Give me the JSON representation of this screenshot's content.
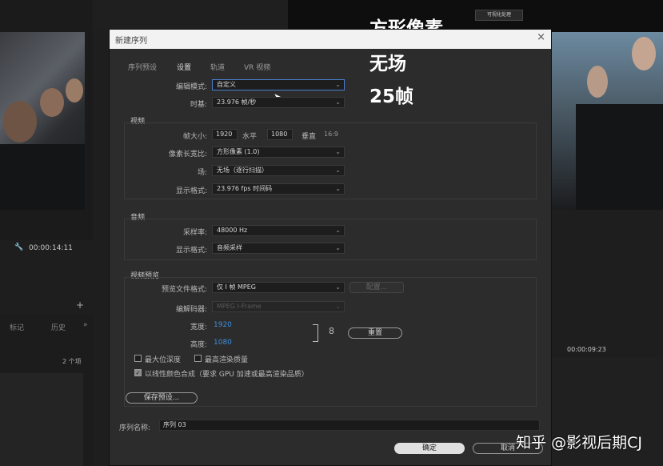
{
  "background": {
    "left_timecode": "00:00:14:11",
    "panel_tabs": [
      "标记",
      "历史"
    ],
    "more_icon": "»",
    "items_count": "2 个项",
    "right_timecode": "00:00:09:23",
    "overlay_lines": [
      "方形像素",
      "无场",
      "25帧"
    ],
    "top_logo_text": "可视化处理"
  },
  "dialog": {
    "title": "新建序列",
    "close_icon": "×",
    "tabs": [
      "序列预设",
      "设置",
      "轨道",
      "VR 视频"
    ],
    "active_tab": "设置",
    "edit_mode_label": "编辑模式:",
    "edit_mode_value": "自定义",
    "timebase_label": "时基:",
    "timebase_value": "23.976 帧/秒",
    "video_section": "视频",
    "frame_size_label": "帧大小:",
    "frame_width": "1920",
    "horizontal_label": "水平",
    "frame_height": "1080",
    "vertical_label": "垂直",
    "aspect_ratio": "16:9",
    "pixel_aspect_label": "像素长宽比:",
    "pixel_aspect_value": "方形像素 (1.0)",
    "fields_label": "场:",
    "fields_value": "无场（逐行扫描）",
    "display_format_label": "显示格式:",
    "display_format_value": "23.976 fps 时间码",
    "audio_section": "音频",
    "sample_rate_label": "采样率:",
    "sample_rate_value": "48000 Hz",
    "audio_display_label": "显示格式:",
    "audio_display_value": "音频采样",
    "preview_section": "视频预览",
    "preview_format_label": "预览文件格式:",
    "preview_format_value": "仅 I 帧 MPEG",
    "configure_button": "配置...",
    "codec_label": "编解码器:",
    "codec_value": "MPEG I-Frame",
    "width_label": "宽度:",
    "width_value": "1920",
    "height_label": "高度:",
    "height_value": "1080",
    "reset_button": "重置",
    "max_bit_depth": "最大位深度",
    "max_render_quality": "最高渲染质量",
    "linear_color": "以线性颜色合成（要求 GPU 加速或最高渲染品质）",
    "save_preset_button": "保存预设...",
    "sequence_name_label": "序列名称:",
    "sequence_name_value": "序列 03",
    "ok_button": "确定",
    "cancel_button": "取消"
  },
  "watermark": "知乎 @影视后期CJ"
}
